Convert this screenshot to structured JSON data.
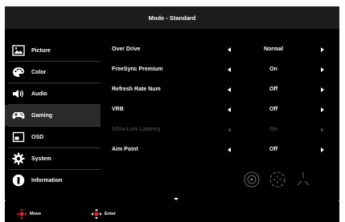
{
  "title": "Mode - Standard",
  "sidebar": {
    "items": [
      {
        "label": "Picture",
        "icon": "picture-icon"
      },
      {
        "label": "Color",
        "icon": "palette-icon"
      },
      {
        "label": "Audio",
        "icon": "speaker-icon"
      },
      {
        "label": "Gaming",
        "icon": "gamepad-icon",
        "active": true
      },
      {
        "label": "OSD",
        "icon": "osd-window-icon"
      },
      {
        "label": "System",
        "icon": "gear-icon"
      },
      {
        "label": "Information",
        "icon": "info-icon"
      }
    ]
  },
  "settings": [
    {
      "label": "Over Drive",
      "value": "Normal",
      "enabled": true
    },
    {
      "label": "FreeSync Premium",
      "value": "On",
      "enabled": true
    },
    {
      "label": "Refresh Rate Num",
      "value": "Off",
      "enabled": true
    },
    {
      "label": "VRB",
      "value": "Off",
      "enabled": true
    },
    {
      "label": "Ultra-Low Latency",
      "value": "On",
      "enabled": false
    },
    {
      "label": "Aim Point",
      "value": "Off",
      "enabled": true
    }
  ],
  "aim_point_options": [
    "aim-point-circle-icon",
    "aim-point-crosshair-icon",
    "aim-point-tri-icon"
  ],
  "footer": {
    "move_label": "Move",
    "enter_label": "Enter"
  },
  "colors": {
    "accent": "#e0232b",
    "background": "#000000",
    "disabled_text": "#444444"
  }
}
